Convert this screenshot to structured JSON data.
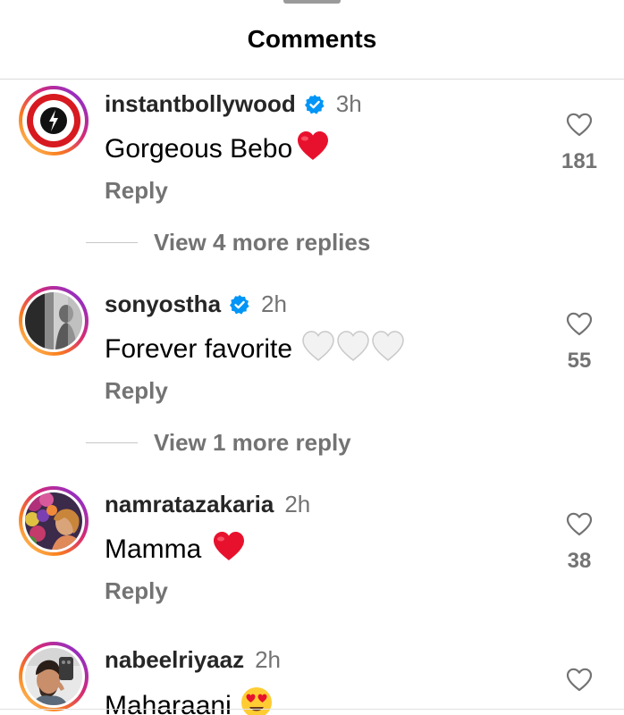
{
  "header": {
    "title": "Comments"
  },
  "comments": [
    {
      "username": "instantbollywood",
      "verified": true,
      "time": "3h",
      "text": "Gorgeous Bebo",
      "emoji": "❤️",
      "reply_label": "Reply",
      "likes": "181",
      "view_more": "View 4 more replies"
    },
    {
      "username": "sonyostha",
      "verified": true,
      "time": "2h",
      "text": "Forever favorite",
      "emoji": "🤍🤍🤍",
      "reply_label": "Reply",
      "likes": "55",
      "view_more": "View 1 more reply"
    },
    {
      "username": "namratazakaria",
      "verified": false,
      "time": "2h",
      "text": "Mamma",
      "emoji": "❤️",
      "reply_label": "Reply",
      "likes": "38"
    },
    {
      "username": "nabeelriyaaz",
      "verified": false,
      "time": "2h",
      "text": "Maharaani",
      "emoji": "😍",
      "likes": ""
    }
  ],
  "icons": {
    "verified": "verified-badge-icon",
    "like": "heart-outline-icon"
  },
  "colors": {
    "verified_blue": "#0095f6",
    "secondary_text": "#737373",
    "heart_red": "#e8112d"
  }
}
